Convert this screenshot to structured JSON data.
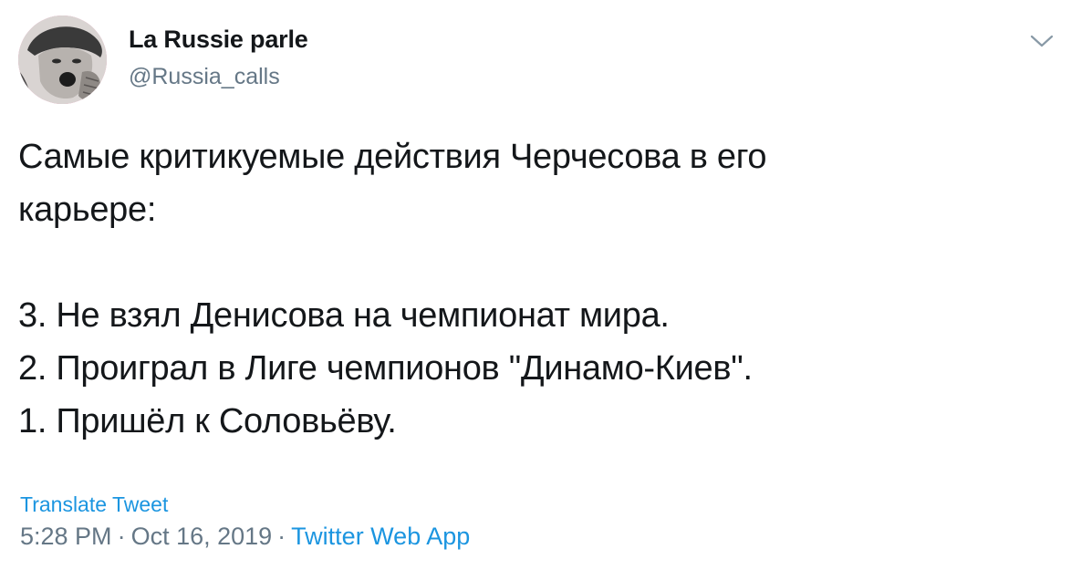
{
  "author": {
    "display_name": "La Russie parle",
    "handle": "@Russia_calls",
    "avatar_icon": "vintage-woman-shouting-avatar",
    "avatar_bg": "#f2aac6"
  },
  "menu": {
    "caret_icon": "chevron-down-icon"
  },
  "tweet": {
    "lines": [
      "Самые критикуемые действия Черчесова в его",
      "карьере:",
      "3. Не взял Денисова на чемпионат мира.",
      "2. Проиграл в Лиге чемпионов \"Динамо-Киев\".",
      "1. Пришёл к Соловьёву."
    ]
  },
  "translate_label": "Translate Tweet",
  "meta": {
    "time": "5:28 PM",
    "date": "Oct 16, 2019",
    "separator": "·",
    "source": "Twitter Web App"
  },
  "colors": {
    "link": "#1b95e0",
    "secondary_text": "#657786",
    "primary_text": "#14171a"
  }
}
